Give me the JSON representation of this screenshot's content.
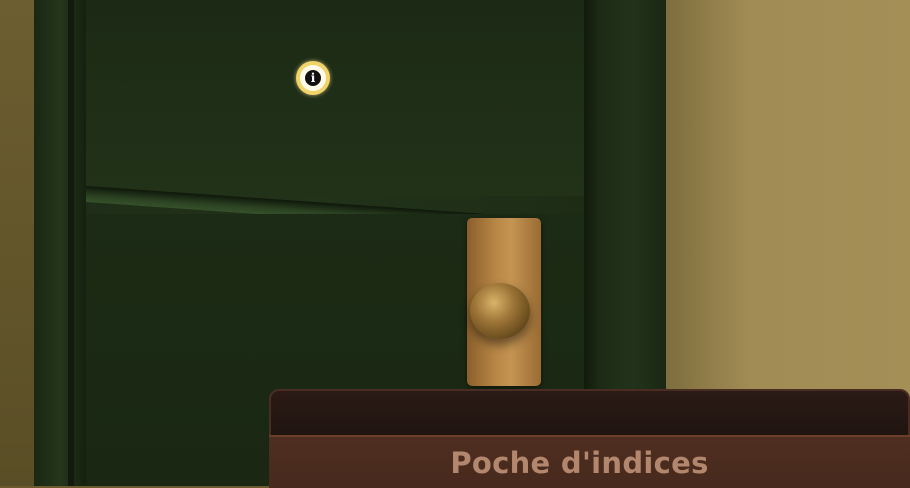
{
  "scene": {
    "name": "door-scene",
    "colors": {
      "door": "#22331a",
      "wall": "#a48f57",
      "brass": "#c49452"
    }
  },
  "hotspot": {
    "icon": "info-icon",
    "glyph": "i",
    "color": "#f1d36a"
  },
  "clue_pocket": {
    "title": "Poche d'indices",
    "background": "#4e2e20",
    "text_color": "#b3876d"
  }
}
